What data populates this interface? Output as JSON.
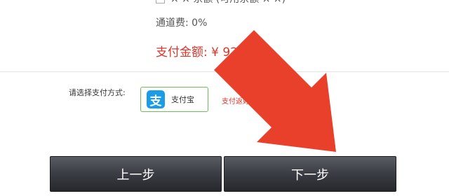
{
  "options": {
    "partial_label": "× × 余额 (可用余额 × ×)"
  },
  "fee": {
    "text": "通道费: 0%"
  },
  "total": {
    "text": "支付金额: ¥ 92"
  },
  "payment": {
    "label": "请选择支付方式:",
    "alipay": {
      "icon_char": "支",
      "name": "支付宝",
      "icon_color": "#1a9de6",
      "border_color": "#6cc052"
    },
    "promo": "支付返好礼, 限量抢"
  },
  "buttons": {
    "prev": "上一步",
    "next": "下一步"
  },
  "annotation": {
    "arrow_color": "#e8402b"
  }
}
